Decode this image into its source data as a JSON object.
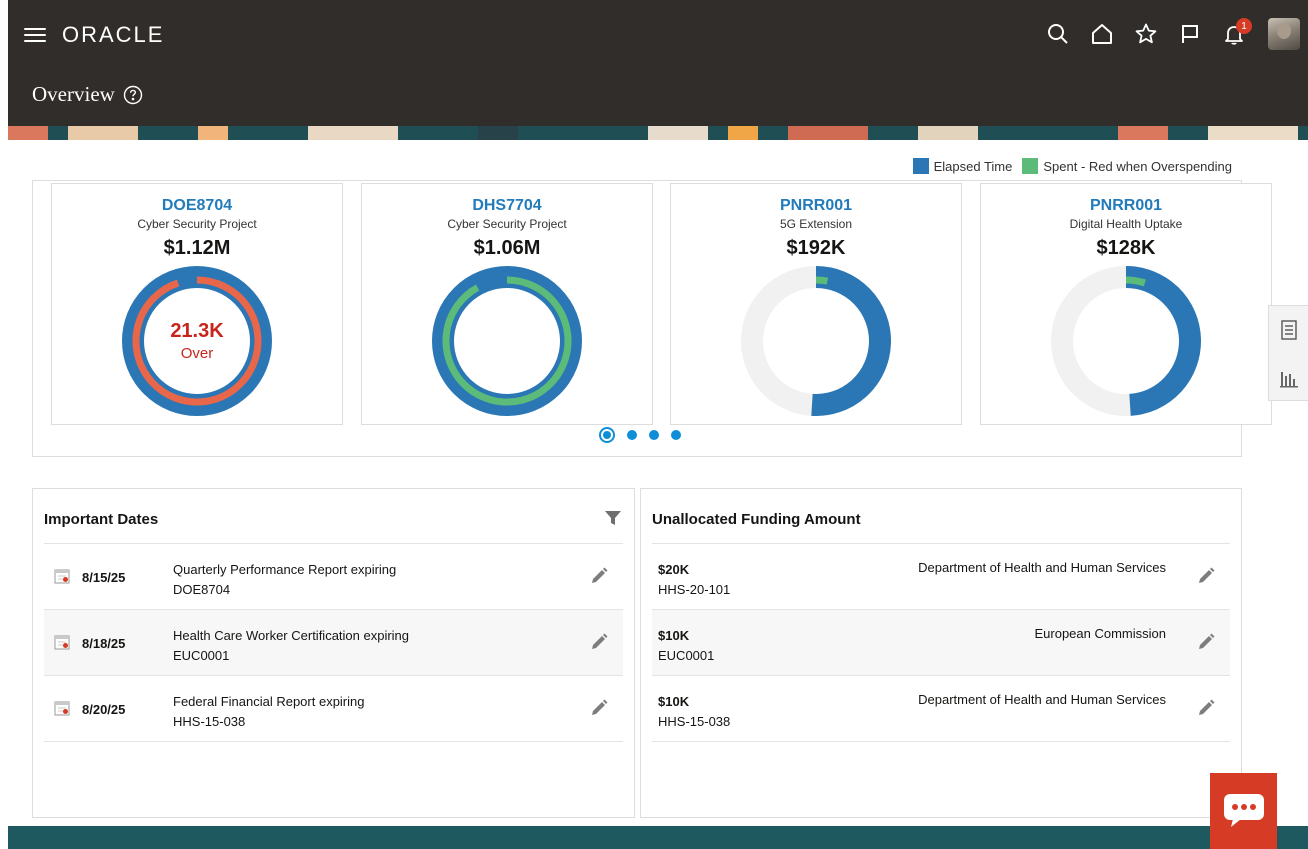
{
  "header": {
    "logo": "ORACLE",
    "page_title": "Overview",
    "notification_count": "1"
  },
  "legend": [
    {
      "label": "Elapsed Time",
      "color": "#2b77b5"
    },
    {
      "label": "Spent - Red when Overspending",
      "color": "#5dbb7a"
    }
  ],
  "colors": {
    "elapsed": "#2b77b5",
    "spent": "#5dbb7a",
    "overspend": "#e8674a",
    "track": "#f1f1f1",
    "link": "#227bbb"
  },
  "cards": [
    {
      "code": "DOE8704",
      "name": "Cyber Security Project",
      "amount": "$1.12M",
      "elapsed_pct": 100,
      "spent_pct": 95,
      "overspend": true,
      "center_big": "21.3K",
      "center_small": "Over"
    },
    {
      "code": "DHS7704",
      "name": "Cyber Security Project",
      "amount": "$1.06M",
      "elapsed_pct": 100,
      "spent_pct": 92,
      "overspend": false,
      "center_big": "",
      "center_small": ""
    },
    {
      "code": "PNRR001",
      "name": "5G Extension",
      "amount": "$192K",
      "elapsed_pct": 51,
      "spent_pct": 3,
      "overspend": false,
      "center_big": "",
      "center_small": ""
    },
    {
      "code": "PNRR001",
      "name": "Digital Health Uptake",
      "amount": "$128K",
      "elapsed_pct": 49,
      "spent_pct": 5,
      "overspend": false,
      "center_big": "",
      "center_small": ""
    }
  ],
  "carousel": {
    "pages": 4,
    "active": 0
  },
  "important_dates": {
    "title": "Important Dates",
    "rows": [
      {
        "date": "8/15/25",
        "desc": "Quarterly Performance Report expiring",
        "ref": "DOE8704"
      },
      {
        "date": "8/18/25",
        "desc": "Health Care Worker Certification expiring",
        "ref": "EUC0001"
      },
      {
        "date": "8/20/25",
        "desc": "Federal Financial Report expiring",
        "ref": "HHS-15-038"
      }
    ]
  },
  "unallocated": {
    "title": "Unallocated Funding Amount",
    "rows": [
      {
        "amount": "$20K",
        "ref": "HHS-20-101",
        "agency": "Department of Health and Human Services"
      },
      {
        "amount": "$10K",
        "ref": "EUC0001",
        "agency": "European Commission"
      },
      {
        "amount": "$10K",
        "ref": "HHS-15-038",
        "agency": "Department of Health and Human Services"
      }
    ]
  }
}
